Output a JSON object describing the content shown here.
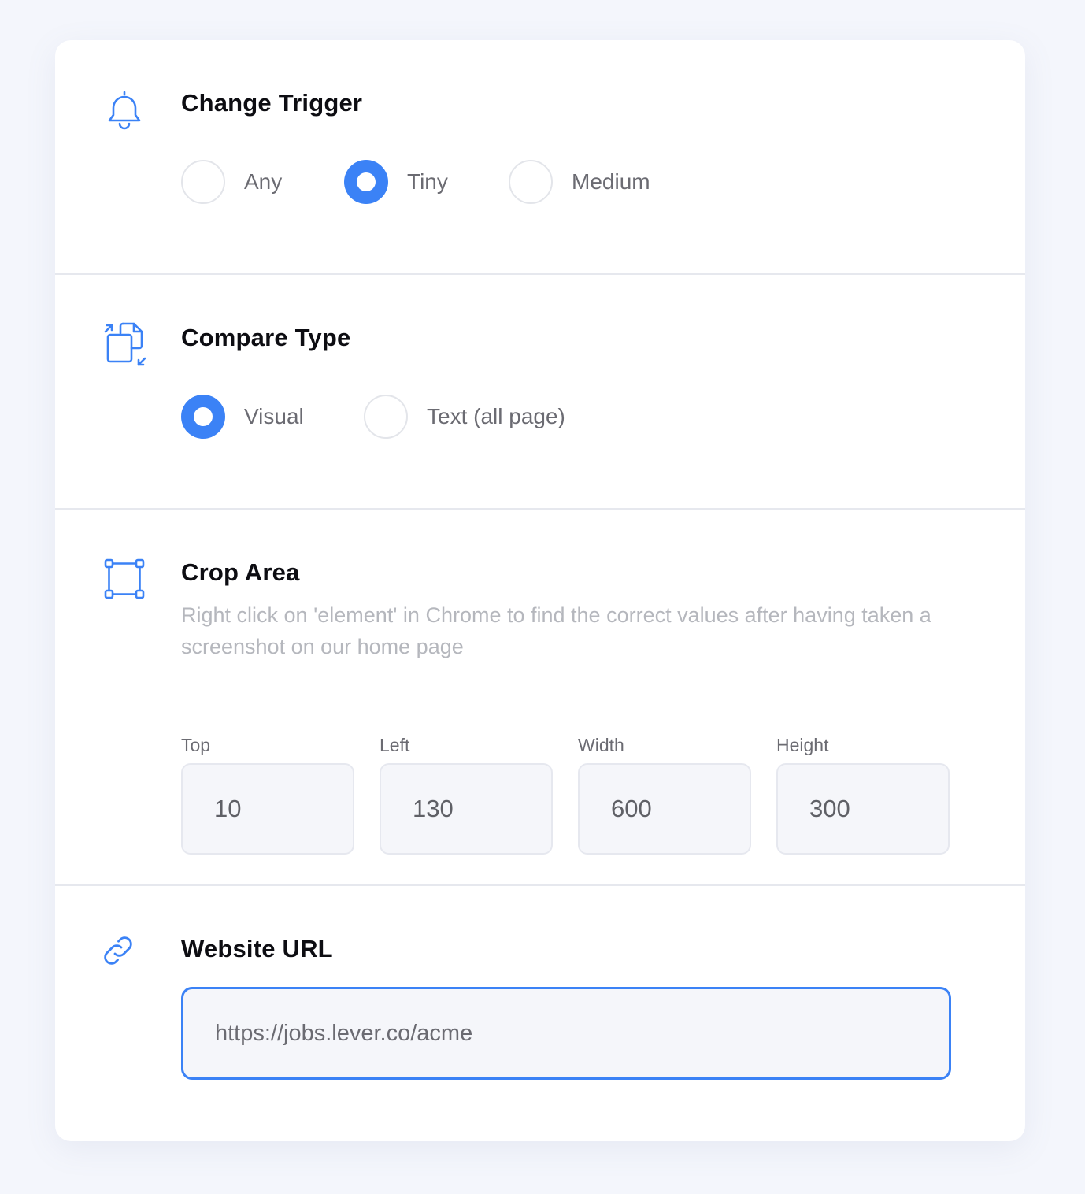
{
  "change_trigger": {
    "title": "Change Trigger",
    "icon": "bell-icon",
    "options": [
      {
        "label": "Any",
        "checked": false
      },
      {
        "label": "Tiny",
        "checked": true
      },
      {
        "label": "Medium",
        "checked": false
      }
    ]
  },
  "compare_type": {
    "title": "Compare Type",
    "icon": "compare-files-icon",
    "options": [
      {
        "label": "Visual",
        "checked": true
      },
      {
        "label": "Text (all page)",
        "checked": false
      }
    ]
  },
  "crop_area": {
    "title": "Crop Area",
    "icon": "crop-frame-icon",
    "help_text": "Right click on 'element' in Chrome to find the correct values after having taken a screenshot on our home page",
    "fields": {
      "top": {
        "label": "Top",
        "value": "10"
      },
      "left": {
        "label": "Left",
        "value": "130"
      },
      "width": {
        "label": "Width",
        "value": "600"
      },
      "height": {
        "label": "Height",
        "value": "300"
      }
    }
  },
  "website_url": {
    "title": "Website URL",
    "icon": "link-icon",
    "placeholder": "https://jobs.lever.co/acme"
  },
  "colors": {
    "accent": "#3b82f6",
    "background": "#f4f6fc",
    "card": "#ffffff"
  }
}
